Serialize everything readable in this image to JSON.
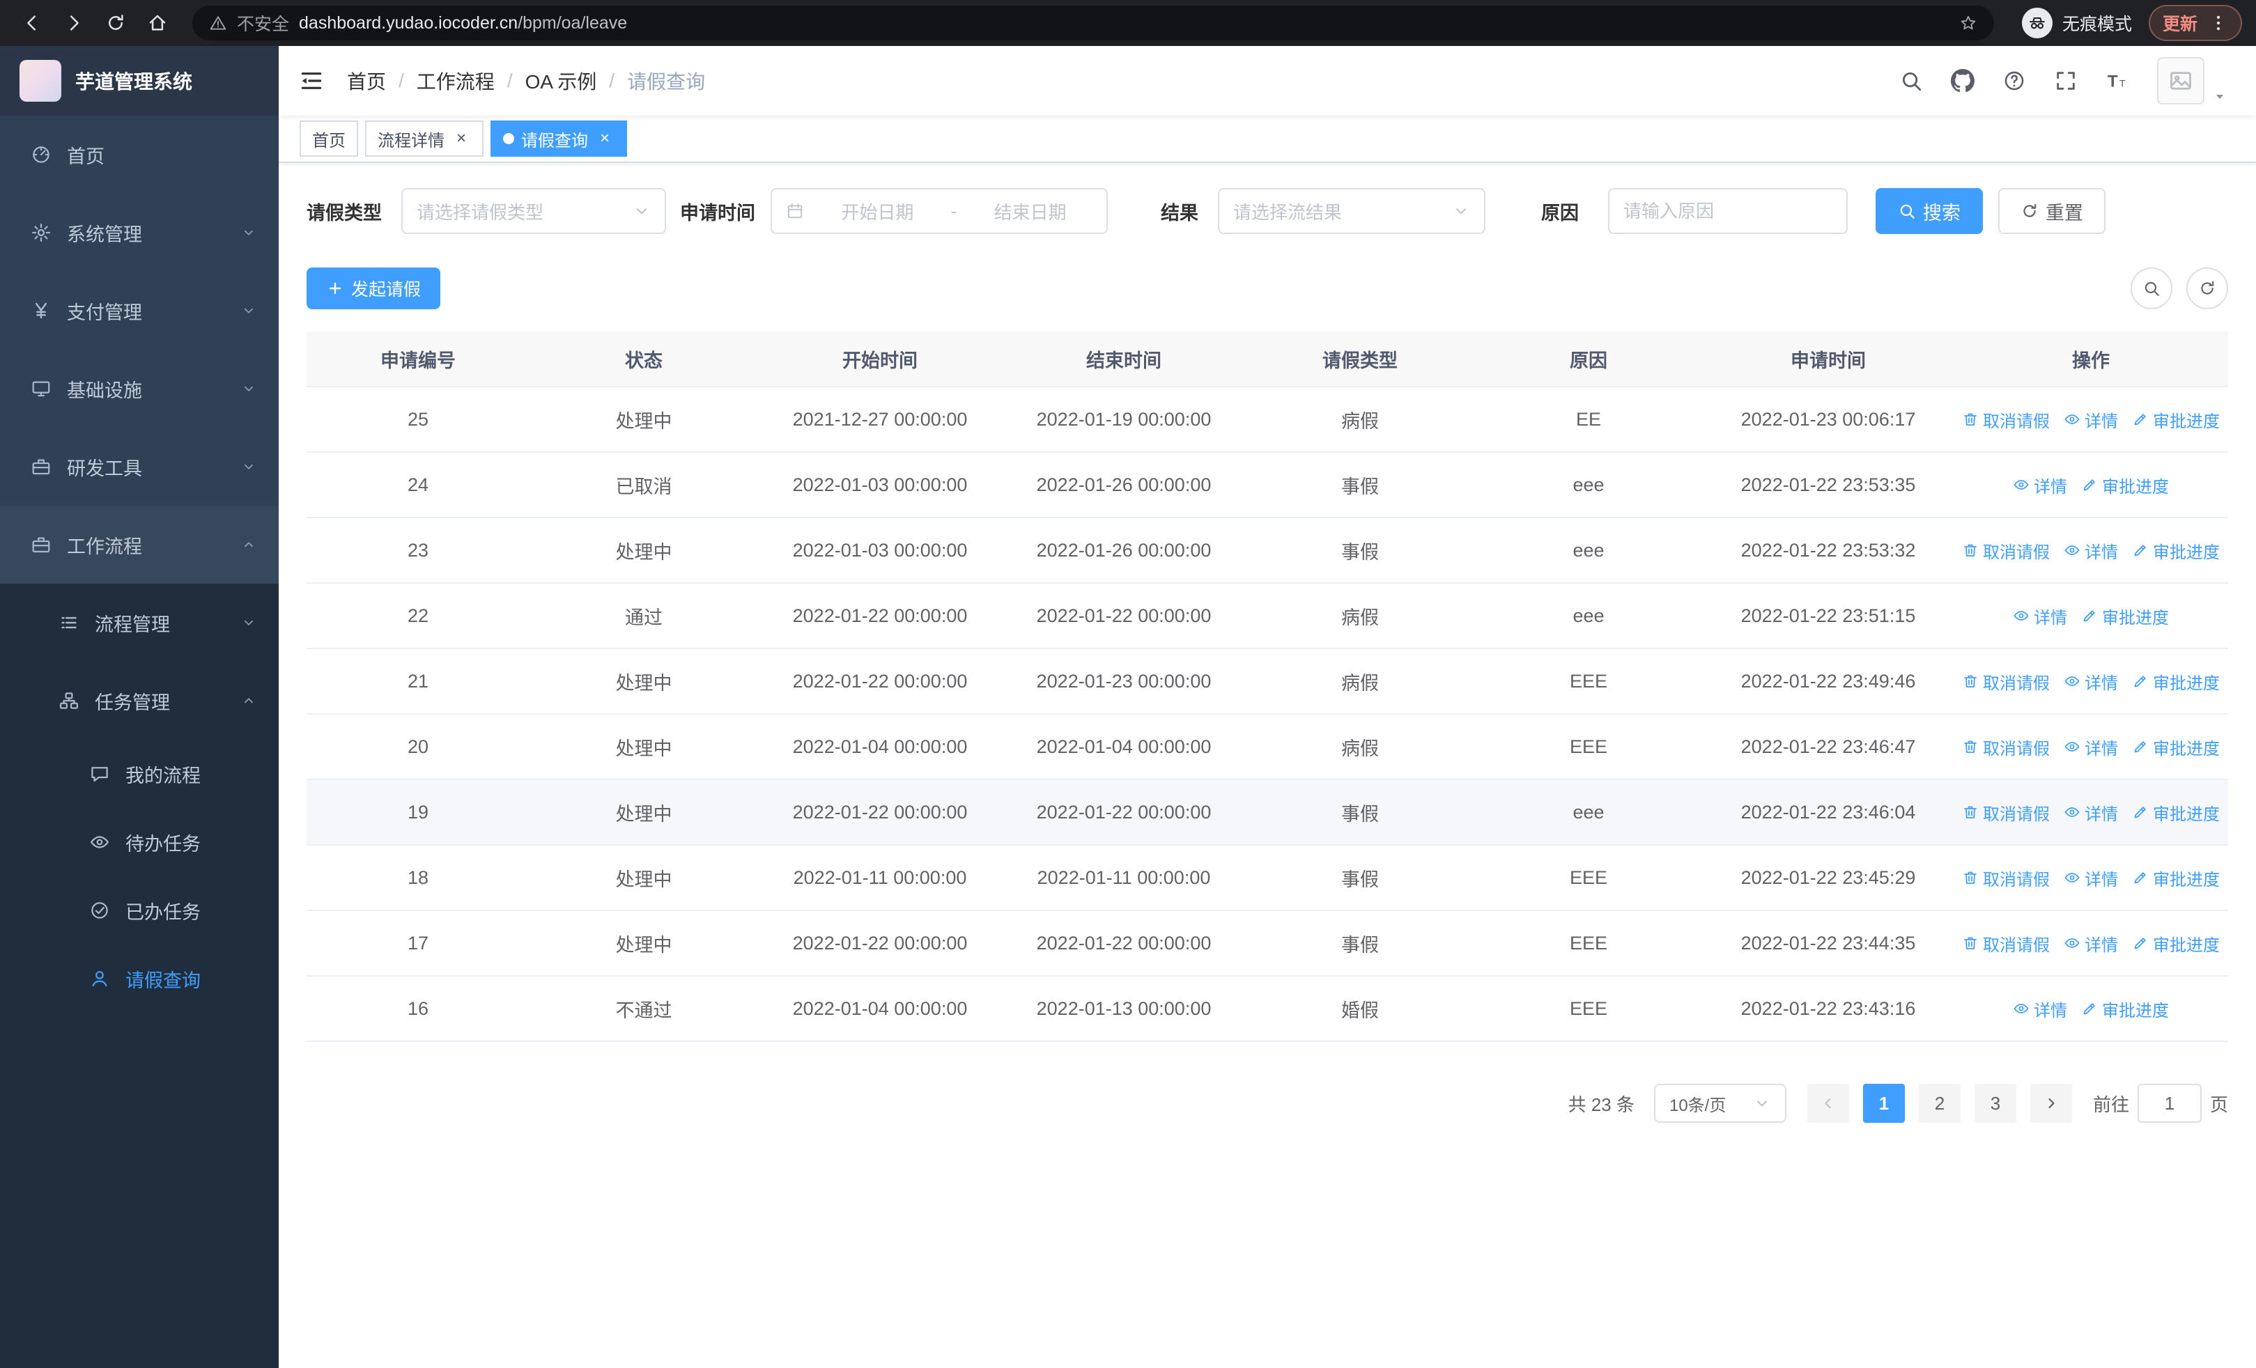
{
  "browser": {
    "security_label": "不安全",
    "url_domain": "dashboard.yudao.iocoder.cn",
    "url_path": "/bpm/oa/leave",
    "incognito_label": "无痕模式",
    "update_label": "更新",
    "icons": [
      "back-icon",
      "forward-icon",
      "reload-icon",
      "home-icon",
      "warning-icon",
      "star-icon",
      "incognito-icon",
      "menu-dots-icon"
    ]
  },
  "sidebar": {
    "app_title": "芋道管理系统",
    "items": [
      {
        "label": "首页",
        "icon": "dashboard-icon"
      },
      {
        "label": "系统管理",
        "icon": "gear-icon",
        "chevron": "down"
      },
      {
        "label": "支付管理",
        "icon": "yen-icon",
        "chevron": "down"
      },
      {
        "label": "基础设施",
        "icon": "monitor-icon",
        "chevron": "down"
      },
      {
        "label": "研发工具",
        "icon": "briefcase-icon",
        "chevron": "down"
      },
      {
        "label": "工作流程",
        "icon": "workflow-icon",
        "chevron": "up",
        "expanded": true
      }
    ],
    "workflow_children": [
      {
        "label": "流程管理",
        "icon": "list-icon",
        "chevron": "down"
      },
      {
        "label": "任务管理",
        "icon": "org-icon",
        "chevron": "up",
        "expanded": true
      }
    ],
    "task_children": [
      {
        "label": "我的流程",
        "icon": "chat-icon"
      },
      {
        "label": "待办任务",
        "icon": "eye-icon"
      },
      {
        "label": "已办任务",
        "icon": "check-icon"
      },
      {
        "label": "请假查询",
        "icon": "user-icon",
        "active": true
      }
    ]
  },
  "header": {
    "breadcrumbs": [
      "首页",
      "工作流程",
      "OA 示例",
      "请假查询"
    ],
    "separator": "/",
    "icons": [
      "search-icon",
      "github-icon",
      "question-icon",
      "fullscreen-icon",
      "font-size-icon",
      "avatar-image",
      "caret-down-icon"
    ]
  },
  "tags": {
    "close_glyph": "×",
    "items": [
      {
        "label": "首页",
        "closable": false,
        "active": false
      },
      {
        "label": "流程详情",
        "closable": true,
        "active": false
      },
      {
        "label": "请假查询",
        "closable": true,
        "active": true
      }
    ]
  },
  "filters": {
    "leave_type_label": "请假类型",
    "leave_type_placeholder": "请选择请假类型",
    "apply_time_label": "申请时间",
    "start_placeholder": "开始日期",
    "range_separator": "-",
    "end_placeholder": "结束日期",
    "result_label": "结果",
    "result_placeholder": "请选择流结果",
    "reason_label": "原因",
    "reason_placeholder": "请输入原因",
    "search_label": "搜索",
    "reset_label": "重置"
  },
  "toolbar": {
    "create_label": "发起请假"
  },
  "table": {
    "columns": [
      "申请编号",
      "状态",
      "开始时间",
      "结束时间",
      "请假类型",
      "原因",
      "申请时间",
      "操作"
    ],
    "actions": {
      "cancel": "取消请假",
      "detail": "详情",
      "progress": "审批进度"
    },
    "rows": [
      {
        "id": "25",
        "status": "处理中",
        "start": "2021-12-27 00:00:00",
        "end": "2022-01-19 00:00:00",
        "type": "病假",
        "reason": "EE",
        "applied": "2022-01-23 00:06:17",
        "cancellable": true,
        "highlighted": false
      },
      {
        "id": "24",
        "status": "已取消",
        "start": "2022-01-03 00:00:00",
        "end": "2022-01-26 00:00:00",
        "type": "事假",
        "reason": "eee",
        "applied": "2022-01-22 23:53:35",
        "cancellable": false,
        "highlighted": false
      },
      {
        "id": "23",
        "status": "处理中",
        "start": "2022-01-03 00:00:00",
        "end": "2022-01-26 00:00:00",
        "type": "事假",
        "reason": "eee",
        "applied": "2022-01-22 23:53:32",
        "cancellable": true,
        "highlighted": false
      },
      {
        "id": "22",
        "status": "通过",
        "start": "2022-01-22 00:00:00",
        "end": "2022-01-22 00:00:00",
        "type": "病假",
        "reason": "eee",
        "applied": "2022-01-22 23:51:15",
        "cancellable": false,
        "highlighted": false
      },
      {
        "id": "21",
        "status": "处理中",
        "start": "2022-01-22 00:00:00",
        "end": "2022-01-23 00:00:00",
        "type": "病假",
        "reason": "EEE",
        "applied": "2022-01-22 23:49:46",
        "cancellable": true,
        "highlighted": false
      },
      {
        "id": "20",
        "status": "处理中",
        "start": "2022-01-04 00:00:00",
        "end": "2022-01-04 00:00:00",
        "type": "病假",
        "reason": "EEE",
        "applied": "2022-01-22 23:46:47",
        "cancellable": true,
        "highlighted": false
      },
      {
        "id": "19",
        "status": "处理中",
        "start": "2022-01-22 00:00:00",
        "end": "2022-01-22 00:00:00",
        "type": "事假",
        "reason": "eee",
        "applied": "2022-01-22 23:46:04",
        "cancellable": true,
        "highlighted": true
      },
      {
        "id": "18",
        "status": "处理中",
        "start": "2022-01-11 00:00:00",
        "end": "2022-01-11 00:00:00",
        "type": "事假",
        "reason": "EEE",
        "applied": "2022-01-22 23:45:29",
        "cancellable": true,
        "highlighted": false
      },
      {
        "id": "17",
        "status": "处理中",
        "start": "2022-01-22 00:00:00",
        "end": "2022-01-22 00:00:00",
        "type": "事假",
        "reason": "EEE",
        "applied": "2022-01-22 23:44:35",
        "cancellable": true,
        "highlighted": false
      },
      {
        "id": "16",
        "status": "不通过",
        "start": "2022-01-04 00:00:00",
        "end": "2022-01-13 00:00:00",
        "type": "婚假",
        "reason": "EEE",
        "applied": "2022-01-22 23:43:16",
        "cancellable": false,
        "highlighted": false
      }
    ]
  },
  "pagination": {
    "total_label": "共 23 条",
    "size_label": "10条/页",
    "pages": [
      "1",
      "2",
      "3"
    ],
    "active_page": "1",
    "goto_label": "前往",
    "goto_value": "1",
    "unit_label": "页"
  },
  "colors": {
    "accent": "#409eff",
    "sidebar_bg": "#304156",
    "submenu_bg": "#1f2d3d",
    "chrome_bg": "#202124"
  }
}
